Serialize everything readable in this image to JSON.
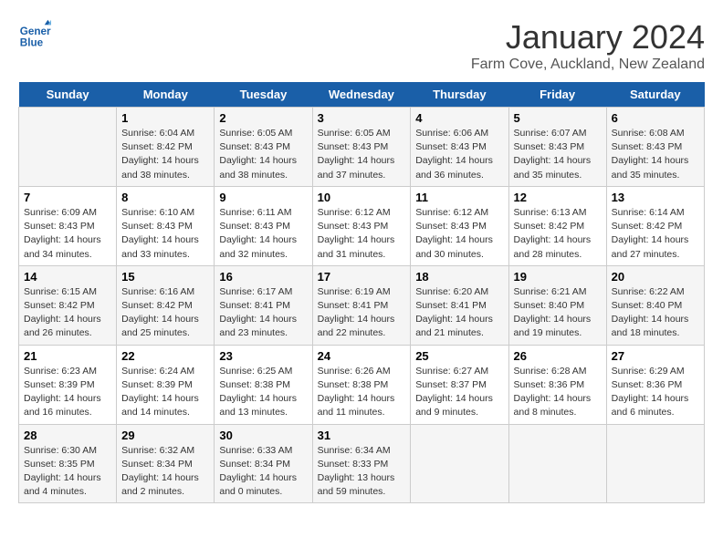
{
  "logo": {
    "line1": "General",
    "line2": "Blue"
  },
  "title": "January 2024",
  "subtitle": "Farm Cove, Auckland, New Zealand",
  "days_of_week": [
    "Sunday",
    "Monday",
    "Tuesday",
    "Wednesday",
    "Thursday",
    "Friday",
    "Saturday"
  ],
  "weeks": [
    [
      {
        "day": "",
        "sunrise": "",
        "sunset": "",
        "daylight": ""
      },
      {
        "day": "1",
        "sunrise": "Sunrise: 6:04 AM",
        "sunset": "Sunset: 8:42 PM",
        "daylight": "Daylight: 14 hours and 38 minutes."
      },
      {
        "day": "2",
        "sunrise": "Sunrise: 6:05 AM",
        "sunset": "Sunset: 8:43 PM",
        "daylight": "Daylight: 14 hours and 38 minutes."
      },
      {
        "day": "3",
        "sunrise": "Sunrise: 6:05 AM",
        "sunset": "Sunset: 8:43 PM",
        "daylight": "Daylight: 14 hours and 37 minutes."
      },
      {
        "day": "4",
        "sunrise": "Sunrise: 6:06 AM",
        "sunset": "Sunset: 8:43 PM",
        "daylight": "Daylight: 14 hours and 36 minutes."
      },
      {
        "day": "5",
        "sunrise": "Sunrise: 6:07 AM",
        "sunset": "Sunset: 8:43 PM",
        "daylight": "Daylight: 14 hours and 35 minutes."
      },
      {
        "day": "6",
        "sunrise": "Sunrise: 6:08 AM",
        "sunset": "Sunset: 8:43 PM",
        "daylight": "Daylight: 14 hours and 35 minutes."
      }
    ],
    [
      {
        "day": "7",
        "sunrise": "Sunrise: 6:09 AM",
        "sunset": "Sunset: 8:43 PM",
        "daylight": "Daylight: 14 hours and 34 minutes."
      },
      {
        "day": "8",
        "sunrise": "Sunrise: 6:10 AM",
        "sunset": "Sunset: 8:43 PM",
        "daylight": "Daylight: 14 hours and 33 minutes."
      },
      {
        "day": "9",
        "sunrise": "Sunrise: 6:11 AM",
        "sunset": "Sunset: 8:43 PM",
        "daylight": "Daylight: 14 hours and 32 minutes."
      },
      {
        "day": "10",
        "sunrise": "Sunrise: 6:12 AM",
        "sunset": "Sunset: 8:43 PM",
        "daylight": "Daylight: 14 hours and 31 minutes."
      },
      {
        "day": "11",
        "sunrise": "Sunrise: 6:12 AM",
        "sunset": "Sunset: 8:43 PM",
        "daylight": "Daylight: 14 hours and 30 minutes."
      },
      {
        "day": "12",
        "sunrise": "Sunrise: 6:13 AM",
        "sunset": "Sunset: 8:42 PM",
        "daylight": "Daylight: 14 hours and 28 minutes."
      },
      {
        "day": "13",
        "sunrise": "Sunrise: 6:14 AM",
        "sunset": "Sunset: 8:42 PM",
        "daylight": "Daylight: 14 hours and 27 minutes."
      }
    ],
    [
      {
        "day": "14",
        "sunrise": "Sunrise: 6:15 AM",
        "sunset": "Sunset: 8:42 PM",
        "daylight": "Daylight: 14 hours and 26 minutes."
      },
      {
        "day": "15",
        "sunrise": "Sunrise: 6:16 AM",
        "sunset": "Sunset: 8:42 PM",
        "daylight": "Daylight: 14 hours and 25 minutes."
      },
      {
        "day": "16",
        "sunrise": "Sunrise: 6:17 AM",
        "sunset": "Sunset: 8:41 PM",
        "daylight": "Daylight: 14 hours and 23 minutes."
      },
      {
        "day": "17",
        "sunrise": "Sunrise: 6:19 AM",
        "sunset": "Sunset: 8:41 PM",
        "daylight": "Daylight: 14 hours and 22 minutes."
      },
      {
        "day": "18",
        "sunrise": "Sunrise: 6:20 AM",
        "sunset": "Sunset: 8:41 PM",
        "daylight": "Daylight: 14 hours and 21 minutes."
      },
      {
        "day": "19",
        "sunrise": "Sunrise: 6:21 AM",
        "sunset": "Sunset: 8:40 PM",
        "daylight": "Daylight: 14 hours and 19 minutes."
      },
      {
        "day": "20",
        "sunrise": "Sunrise: 6:22 AM",
        "sunset": "Sunset: 8:40 PM",
        "daylight": "Daylight: 14 hours and 18 minutes."
      }
    ],
    [
      {
        "day": "21",
        "sunrise": "Sunrise: 6:23 AM",
        "sunset": "Sunset: 8:39 PM",
        "daylight": "Daylight: 14 hours and 16 minutes."
      },
      {
        "day": "22",
        "sunrise": "Sunrise: 6:24 AM",
        "sunset": "Sunset: 8:39 PM",
        "daylight": "Daylight: 14 hours and 14 minutes."
      },
      {
        "day": "23",
        "sunrise": "Sunrise: 6:25 AM",
        "sunset": "Sunset: 8:38 PM",
        "daylight": "Daylight: 14 hours and 13 minutes."
      },
      {
        "day": "24",
        "sunrise": "Sunrise: 6:26 AM",
        "sunset": "Sunset: 8:38 PM",
        "daylight": "Daylight: 14 hours and 11 minutes."
      },
      {
        "day": "25",
        "sunrise": "Sunrise: 6:27 AM",
        "sunset": "Sunset: 8:37 PM",
        "daylight": "Daylight: 14 hours and 9 minutes."
      },
      {
        "day": "26",
        "sunrise": "Sunrise: 6:28 AM",
        "sunset": "Sunset: 8:36 PM",
        "daylight": "Daylight: 14 hours and 8 minutes."
      },
      {
        "day": "27",
        "sunrise": "Sunrise: 6:29 AM",
        "sunset": "Sunset: 8:36 PM",
        "daylight": "Daylight: 14 hours and 6 minutes."
      }
    ],
    [
      {
        "day": "28",
        "sunrise": "Sunrise: 6:30 AM",
        "sunset": "Sunset: 8:35 PM",
        "daylight": "Daylight: 14 hours and 4 minutes."
      },
      {
        "day": "29",
        "sunrise": "Sunrise: 6:32 AM",
        "sunset": "Sunset: 8:34 PM",
        "daylight": "Daylight: 14 hours and 2 minutes."
      },
      {
        "day": "30",
        "sunrise": "Sunrise: 6:33 AM",
        "sunset": "Sunset: 8:34 PM",
        "daylight": "Daylight: 14 hours and 0 minutes."
      },
      {
        "day": "31",
        "sunrise": "Sunrise: 6:34 AM",
        "sunset": "Sunset: 8:33 PM",
        "daylight": "Daylight: 13 hours and 59 minutes."
      },
      {
        "day": "",
        "sunrise": "",
        "sunset": "",
        "daylight": ""
      },
      {
        "day": "",
        "sunrise": "",
        "sunset": "",
        "daylight": ""
      },
      {
        "day": "",
        "sunrise": "",
        "sunset": "",
        "daylight": ""
      }
    ]
  ]
}
